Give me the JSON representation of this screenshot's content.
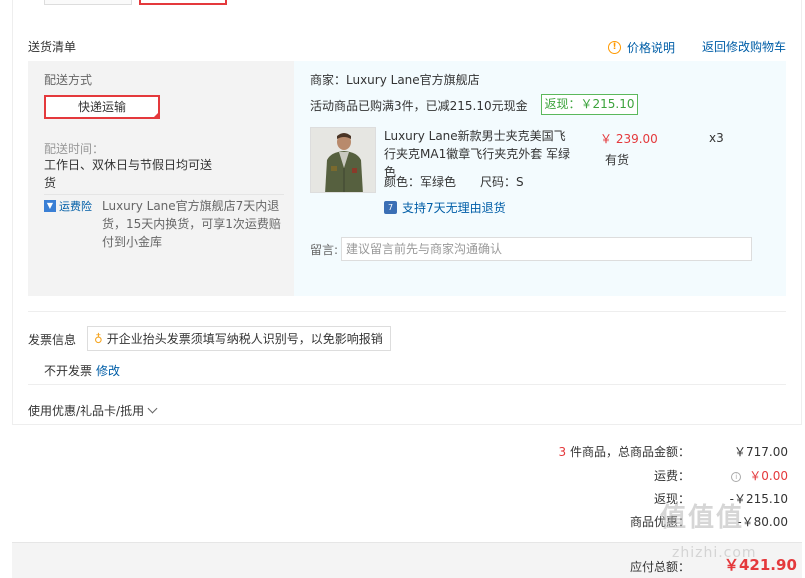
{
  "header": {
    "section_title": "送货清单",
    "price_note": "价格说明",
    "back_to_cart": "返回修改购物车"
  },
  "shipping": {
    "method_label": "配送方式",
    "method_value": "快递运输",
    "time_label": "配送时间：",
    "time_value": "工作日、双休日与节假日均可送货",
    "insurance_tag": "运费险",
    "insurance_text": "Luxury Lane官方旗舰店7天内退货，15天内换货，可享1次运费赔付到小金库"
  },
  "merchant": {
    "name": "商家：Luxury Lane官方旗舰店",
    "promo": "活动商品已购满3件，已减215.10元现金",
    "rebate": "返现：￥215.10"
  },
  "product": {
    "name": "Luxury Lane新款男士夹克美国飞行夹克MA1徽章飞行夹克外套 军绿色",
    "price": "￥ 239.00",
    "stock": "有货",
    "qty": "x3",
    "color": "颜色：军绿色",
    "size": "尺码：S",
    "return_policy": "支持7天无理由退货"
  },
  "message": {
    "label": "留言:",
    "placeholder": "建议留言前先与商家沟通确认"
  },
  "invoice": {
    "title": "发票信息",
    "tip": "开企业抬头发票须填写纳税人识别号，以免影响报销",
    "value": "不开发票",
    "edit": "修改"
  },
  "coupon": {
    "label": "使用优惠/礼品卡/抵用"
  },
  "summary": {
    "count": "3",
    "count_suffix": "件商品，总商品金额：",
    "goods_total": "￥717.00",
    "shipping_label": "运费：",
    "shipping_value": "￥0.00",
    "rebate_label": "返现：",
    "rebate_value": "-￥215.10",
    "discount_label": "商品优惠：",
    "discount_value": "-￥80.00",
    "payable_label": "应付总额：",
    "payable_value": "￥421.90"
  },
  "watermark": {
    "main": "值值值",
    "sub": "zhizhi.com"
  },
  "colors": {
    "accent_red": "#e4393c",
    "link_blue": "#005ea7",
    "rebate_green": "#3ca33c"
  }
}
